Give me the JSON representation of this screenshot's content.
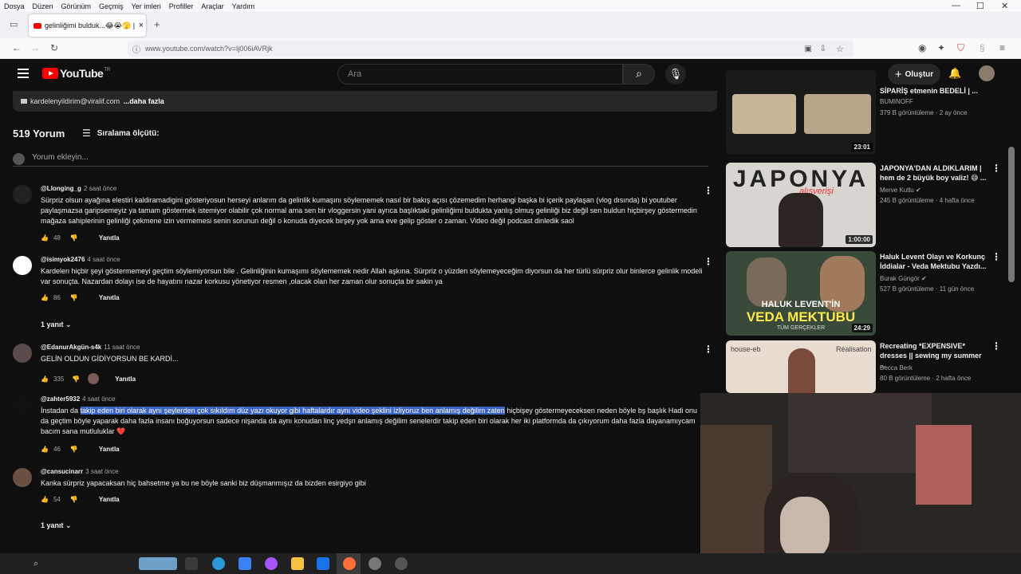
{
  "browser": {
    "menu": [
      "Dosya",
      "Düzen",
      "Görünüm",
      "Geçmiş",
      "Yer imleri",
      "Profiller",
      "Araçlar",
      "Yardım"
    ],
    "tab_title": "gelinliğimi bulduk...😂😭🫣 | nil",
    "url_prefix": "www.youtube.com",
    "url_path": "/watch?v=Ij006iAVRjk"
  },
  "yt": {
    "logo": "YouTube",
    "country": "TR",
    "search_placeholder": "Ara",
    "create_label": "Oluştur",
    "email": "kardelenyildirim@viralif.com",
    "more": "...daha fazla",
    "comment_count": "519 Yorum",
    "sort_label": "Sıralama ölçütü:",
    "add_comment": "Yorum ekleyin...",
    "reply_label": "Yanıtla",
    "replies_label": "1 yanıt"
  },
  "comments": [
    {
      "user": "@Llonging_g",
      "time": "2 saat önce",
      "text": "Sürpriz olsun ayağına elestiri kaldiramadigini gösteriyosun herseyi anlarım da gelinlik kumaşını söylememek nasıl bir bakış açısı çözemedim herhangi başka bi içerik paylaşan (vlog dısında) bi youtuber paylaşmazsa garipsemeyiz ya tamam göstermek istemiyor olabilir çok normal ama sen bir vloggersin yani ayrıca başlıktaki gelinliğimi bulduktа yanlış olmuş gelinliği biz değil sen buldun hiçbirşey göstermedin mağaza sahiplerinin gelinliği çekmene izin vermemesi senin sorunun değil o konuda diyecek birşey yok ama eve gelip göster o zaman. Video değil podcast dinledik saol",
      "likes": "48"
    },
    {
      "user": "@isimyok2476",
      "time": "4 saat önce",
      "text": "Kardelen hiçbir şeyi göstermemeyi geçtim söylemiyorsun bile . Gelinliğinin kumaşımı söylememek nedir Allah aşkına. Sürpriz o yüzden söylemeyeceğim diyorsun da her türlü sürpriz olur binlerce gelinlik modeli var sonuçta. Nazardan dolayı ise de hayatını nazar korkusu yönetiyor resmen ,olacak olan her zaman olur sonuçta bir sakin ya",
      "likes": "86"
    },
    {
      "user": "@EdanurAkgün-s4k",
      "time": "11 saat önce",
      "text": "GELİN OLDUN GİDİYORSUN BE KARDİ...",
      "likes": "335"
    },
    {
      "user": "@zahter5932",
      "time": "4 saat önce",
      "pre": "İnstadan da ",
      "sel": "takip eden biri olarak aynı şeylerden çok sıkıldım düz yazı okuyor gibi haftalardır aynı video şeklini izliyoruz ben anlamış değilim zaten",
      "post": " hiçbişey göstermeyeceksen neden böyle bş başlık Hadi onu da geçtim böyle yaparak daha fazla insanı boğuyorsun sadece nişanda da aynı konudan linç yedşn anlamış değilim senelerdir takip eden biri olarak her iki platformda da çıkıyorum daha fazla dayanamıycam bacım sana mutluluklar ❤️",
      "likes": "46"
    },
    {
      "user": "@cansucinarr",
      "time": "3 saat önce",
      "text": "Kanka sürpriz yapacaksan hiç bahsetme ya bu ne böyle sanki biz düşmanmışız da bizden esirgiyo gibi",
      "likes": "54"
    }
  ],
  "related": [
    {
      "title": "SİPARİŞ etmenin BEDELİ | ...",
      "channel": "BUMINOFF",
      "views": "379 B görüntüleme · 2 ay önce",
      "duration": "23:01"
    },
    {
      "title": "JAPONYA'DAN ALDIKLARIM | hem de 2 büyük boy valiz! 😅 ...",
      "channel": "Merve Kutlu",
      "views": "245 B görüntüleme · 4 hafta önce",
      "duration": "1:00:00",
      "thumb_text": "JAPONYA",
      "thumb_sub": "alışverişi"
    },
    {
      "title": "Haluk Levent Olayı ve Korkunç İddialar - Veda Mektubu Yazdı...",
      "channel": "Burak Güngör",
      "views": "527 B görüntüleme · 11 gün önce",
      "duration": "24:29",
      "thumb_text1": "HALUK LEVENT'İN",
      "thumb_text2": "VEDA MEKTUBU",
      "thumb_text3": "TÜM GERÇEKLER"
    },
    {
      "title": "Recreating *EXPENSIVE* dresses || sewing my summer ...",
      "channel": "Becca Berk",
      "views": "80 B görüntüleme · 2 hafta önce",
      "thumb_text1": "house-eb",
      "thumb_text2": "Réalisation"
    }
  ],
  "colors": {
    "selection": "#3a63c5",
    "yt_red": "#ff0000",
    "bg": "#0f0f0f"
  }
}
